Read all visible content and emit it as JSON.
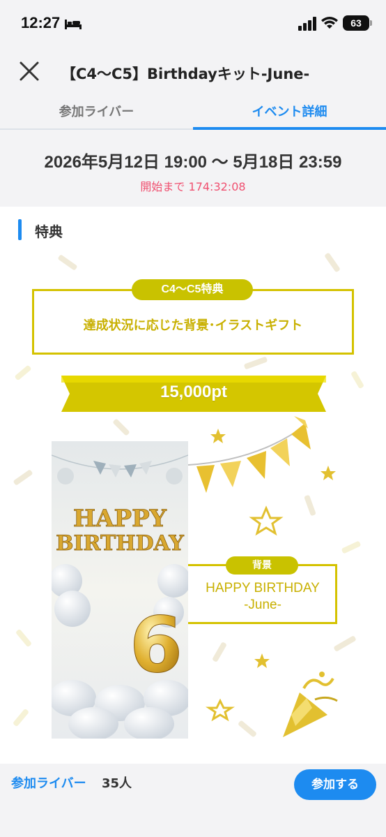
{
  "status_bar": {
    "time": "12:27",
    "battery": "63"
  },
  "header": {
    "title": "【C4〜C5】Birthdayキット-June-"
  },
  "tabs": [
    {
      "label": "参加ライバー",
      "active": false
    },
    {
      "label": "イベント詳細",
      "active": true
    }
  ],
  "event": {
    "date_range": "2026年5月12日 19:00 〜 5月18日 23:59",
    "countdown": "開始まで 174:32:08"
  },
  "section": {
    "title": "特典"
  },
  "reward": {
    "tag": "C4〜C5特典",
    "description": "達成状況に応じた背景･イラストギフト",
    "points": "15,000pt"
  },
  "background_item": {
    "tag": "背景",
    "name_line1": "HAPPY BIRTHDAY",
    "name_line2": "-June-",
    "illustration_text1": "HAPPY",
    "illustration_text2": "BIRTHDAY",
    "illustration_number": "6"
  },
  "bottom_bar": {
    "participants_label": "参加ライバー",
    "participants_count": "35人",
    "join_label": "参加する"
  },
  "colors": {
    "accent_blue": "#1d8bf0",
    "countdown_red": "#f05070",
    "reward_yellow": "#c9c200",
    "background_gray": "#f3f3f5"
  }
}
